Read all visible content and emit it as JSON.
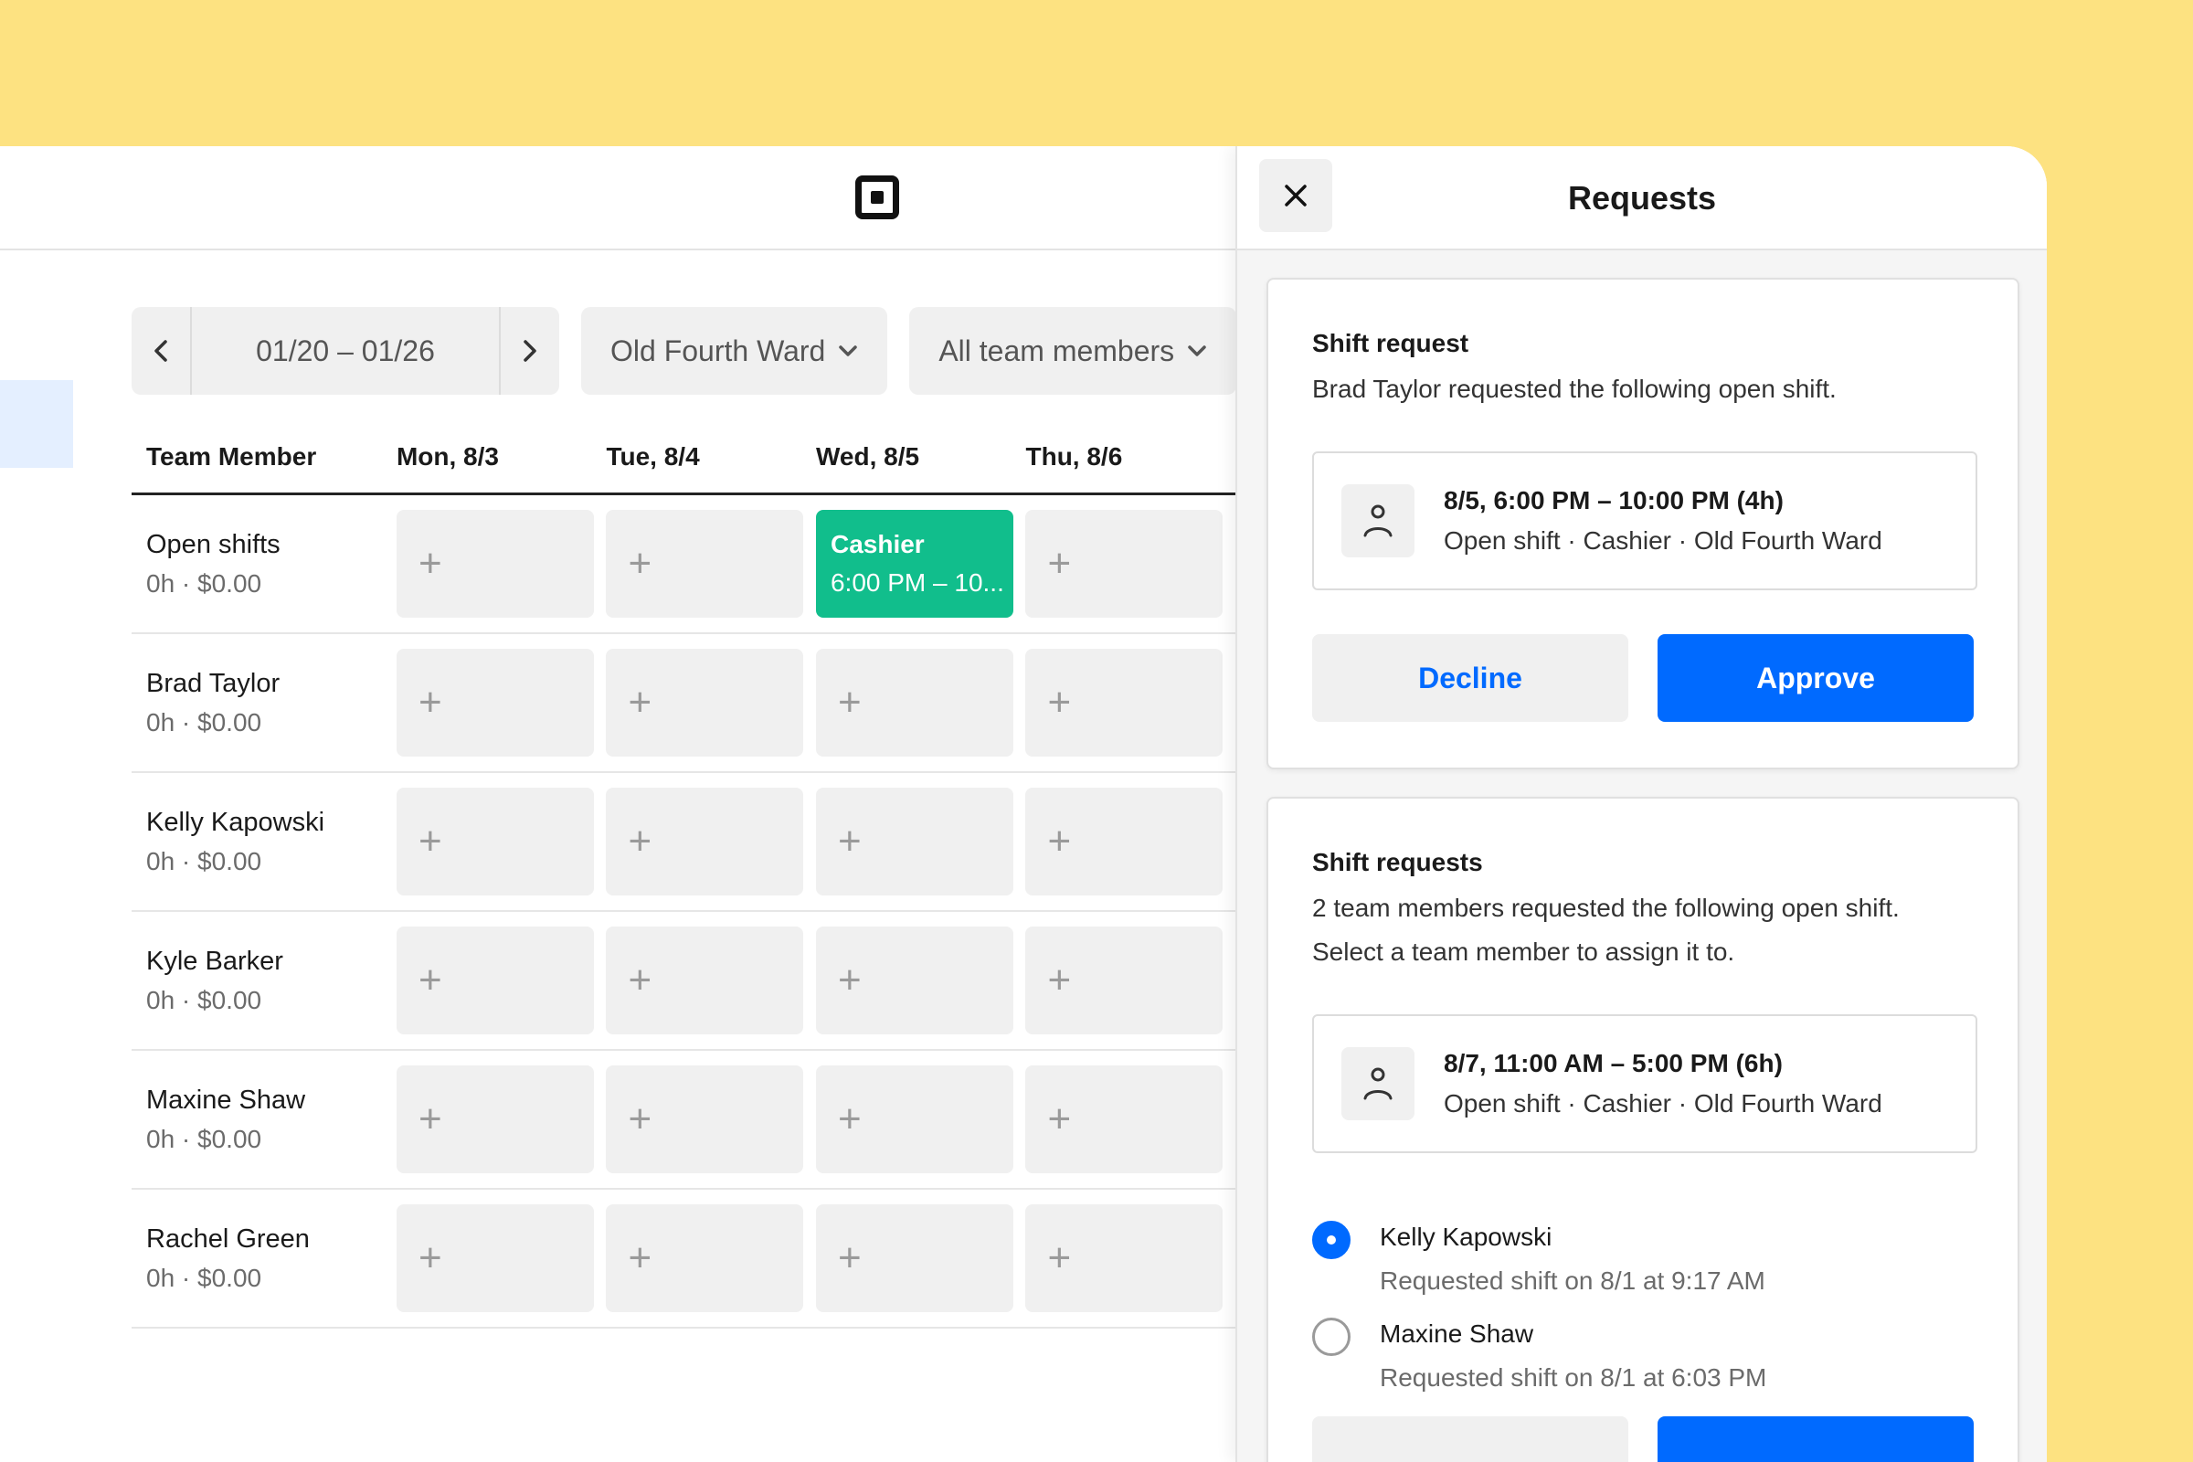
{
  "toolbar": {
    "date_range": "01/20 – 01/26",
    "location": "Old Fourth Ward",
    "members_filter": "All team members"
  },
  "schedule": {
    "headers": [
      "Team Member",
      "Mon, 8/3",
      "Tue, 8/4",
      "Wed, 8/5",
      "Thu, 8/6"
    ],
    "rows": [
      {
        "name": "Open shifts",
        "meta": "0h · $0.00"
      },
      {
        "name": "Brad Taylor",
        "meta": "0h · $0.00"
      },
      {
        "name": "Kelly Kapowski",
        "meta": "0h · $0.00"
      },
      {
        "name": "Kyle Barker",
        "meta": "0h · $0.00"
      },
      {
        "name": "Maxine Shaw",
        "meta": "0h · $0.00"
      },
      {
        "name": "Rachel Green",
        "meta": "0h · $0.00"
      }
    ],
    "add_glyph": "+",
    "open_shift": {
      "role": "Cashier",
      "time": "6:00 PM – 10..."
    }
  },
  "panel": {
    "title": "Requests",
    "card1": {
      "heading": "Shift request",
      "description": "Brad Taylor requested the following open shift.",
      "shift_time": "8/5, 6:00 PM – 10:00 PM (4h)",
      "shift_detail": "Open shift · Cashier · Old Fourth Ward",
      "decline_label": "Decline",
      "approve_label": "Approve"
    },
    "card2": {
      "heading": "Shift requests",
      "description1": "2 team members requested the following open shift.",
      "description2": "Select a team member to assign it to.",
      "shift_time": "8/7, 11:00 AM – 5:00 PM (6h)",
      "shift_detail": "Open shift · Cashier · Old Fourth Ward",
      "candidates": [
        {
          "name": "Kelly Kapowski",
          "meta": "Requested shift on 8/1 at 9:17 AM",
          "selected": true
        },
        {
          "name": "Maxine Shaw",
          "meta": "Requested shift on 8/1 at 6:03 PM",
          "selected": false
        }
      ]
    }
  },
  "colors": {
    "background": "#fde281",
    "accent": "#006aff",
    "shift_green": "#11be8c"
  }
}
